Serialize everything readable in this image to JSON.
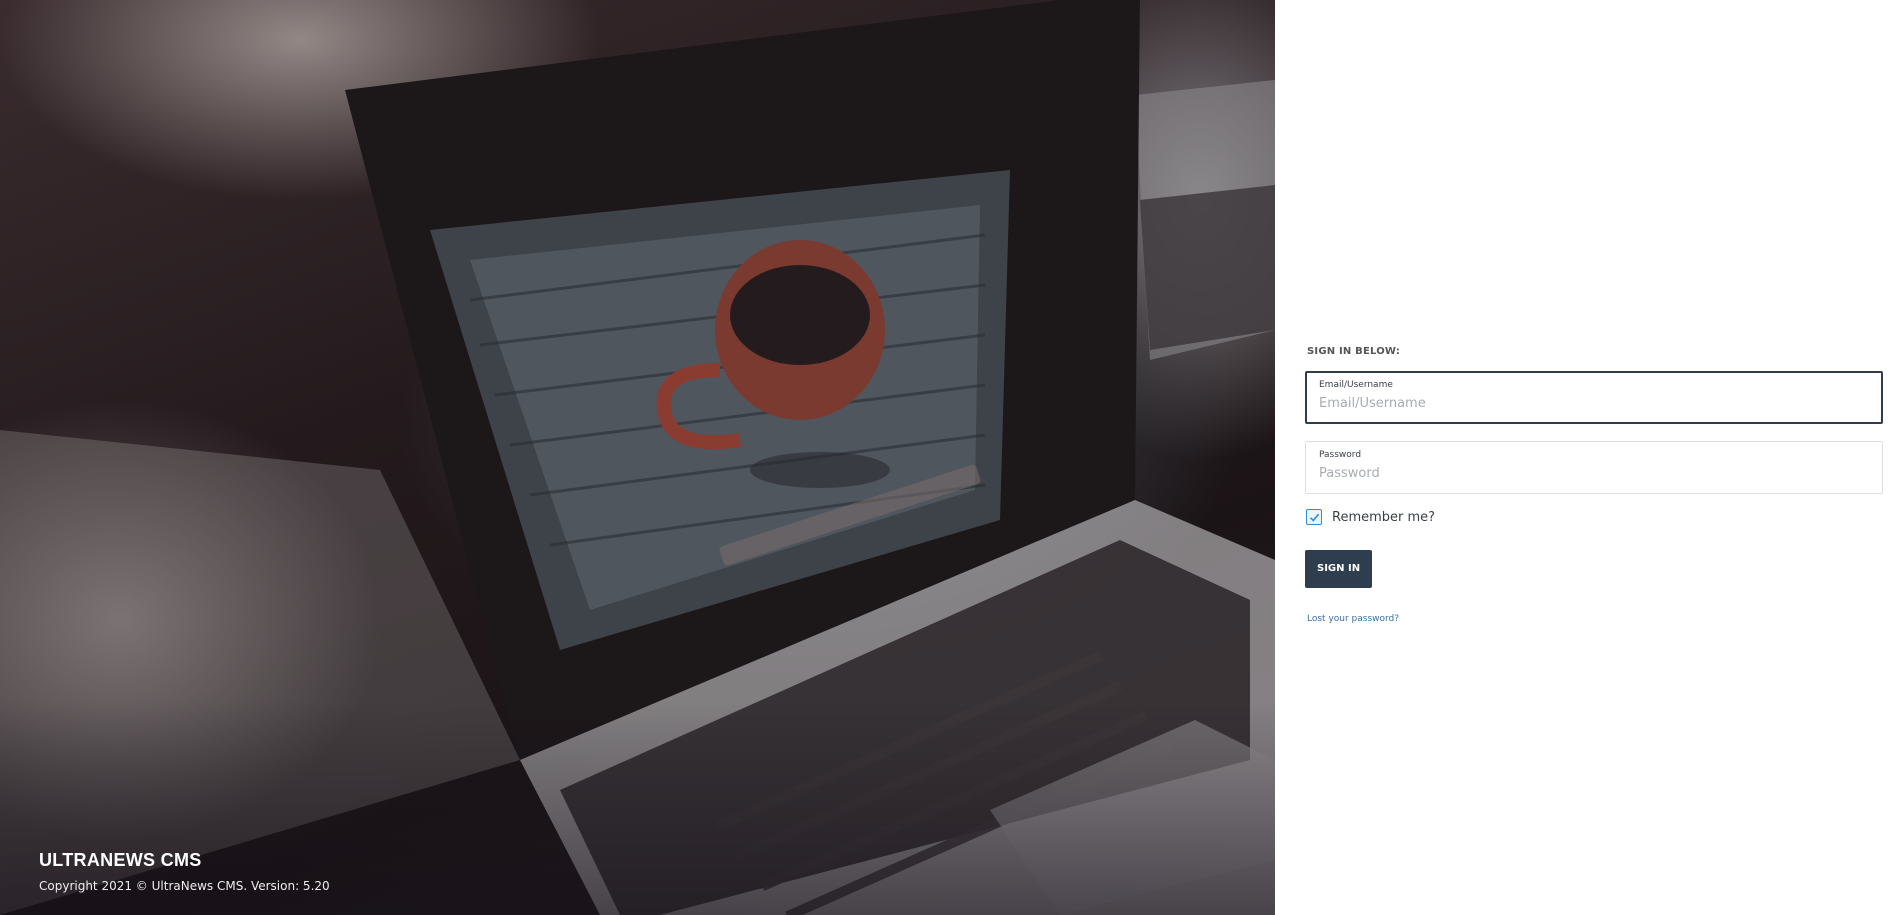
{
  "hero": {
    "title": "ULTRANEWS CMS",
    "copyright": "Copyright 2021 © UltraNews CMS. Version: 5.20"
  },
  "signin": {
    "heading": "SIGN IN BELOW:",
    "email": {
      "label": "Email/Username",
      "placeholder": "Email/Username",
      "value": ""
    },
    "password": {
      "label": "Password",
      "placeholder": "Password",
      "value": ""
    },
    "remember_label": "Remember me?",
    "remember_checked": true,
    "submit_label": "SIGN IN",
    "lost_password_label": "Lost your password?"
  },
  "colors": {
    "primary": "#2f3e4e",
    "link": "#3b6fa6",
    "checkbox_accent": "#2d8fd5"
  },
  "icons": {
    "checkbox": "checkmark-icon"
  }
}
